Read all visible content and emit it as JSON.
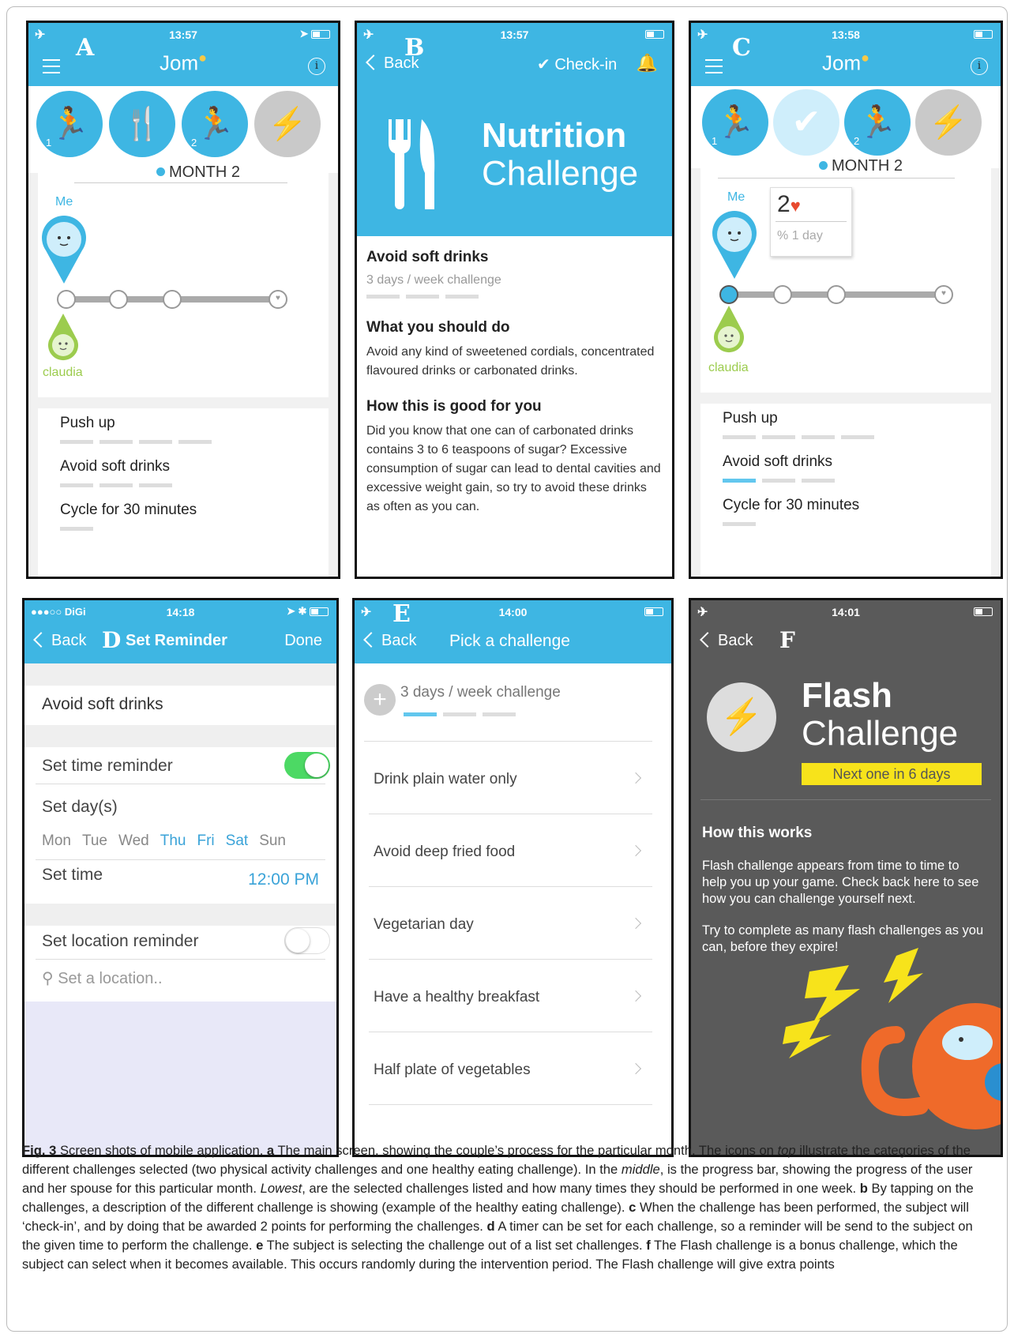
{
  "panel_a": {
    "letter": "A",
    "time": "13:57",
    "app_title": "Jom",
    "icon_badges": [
      "1",
      "2"
    ],
    "month": "MONTH 2",
    "me_label": "Me",
    "spouse_label": "claudia",
    "challenges": [
      {
        "title": "Push up",
        "segments": 4,
        "done": 0
      },
      {
        "title": "Avoid soft drinks",
        "segments": 3,
        "done": 0
      },
      {
        "title": "Cycle for 30 minutes",
        "segments": 1,
        "done": 0
      }
    ]
  },
  "panel_b": {
    "letter": "B",
    "time": "13:57",
    "back": "Back",
    "checkin": "Check-in",
    "hero_title": "Nutrition",
    "hero_subtitle": "Challenge",
    "challenge_title": "Avoid soft drinks",
    "frequency": "3 days / week challenge",
    "what_heading": "What you should do",
    "what_text": "Avoid any kind of sweetened cordials, concentrated flavoured drinks or carbonated drinks.",
    "how_heading": "How this is good for you",
    "how_text": "Did you know that one can of carbonated drinks contains 3 to 6 teaspoons of sugar? Excessive consumption of sugar can lead to dental cavities and excessive weight gain, so try to avoid these drinks as often as you can."
  },
  "panel_c": {
    "letter": "C",
    "time": "13:58",
    "app_title": "Jom",
    "icon_badges": [
      "1",
      "2"
    ],
    "month": "MONTH 2",
    "me_label": "Me",
    "points": "2",
    "streak": "1 day",
    "spouse_label": "claudia",
    "challenges": [
      {
        "title": "Push up",
        "segments": 4,
        "done": 0
      },
      {
        "title": "Avoid soft drinks",
        "segments": 3,
        "done": 1
      },
      {
        "title": "Cycle for 30 minutes",
        "segments": 1,
        "done": 0
      }
    ]
  },
  "panel_d": {
    "letter": "D",
    "carrier": "●●●○○ DiGi",
    "time": "14:18",
    "back": "Back",
    "title": "Set Reminder",
    "done": "Done",
    "challenge": "Avoid soft drinks",
    "time_reminder_label": "Set time reminder",
    "time_reminder_on": true,
    "days_label": "Set day(s)",
    "days": [
      {
        "d": "Mon",
        "sel": false
      },
      {
        "d": "Tue",
        "sel": false
      },
      {
        "d": "Wed",
        "sel": false
      },
      {
        "d": "Thu",
        "sel": true
      },
      {
        "d": "Fri",
        "sel": true
      },
      {
        "d": "Sat",
        "sel": true
      },
      {
        "d": "Sun",
        "sel": false
      }
    ],
    "set_time_label": "Set time",
    "set_time_value": "12:00 PM",
    "location_label": "Set location reminder",
    "location_on": false,
    "location_placeholder": "Set a location.."
  },
  "panel_e": {
    "letter": "E",
    "time": "14:00",
    "back": "Back",
    "title": "Pick a challenge",
    "frequency": "3 days / week challenge",
    "items": [
      "Drink plain water only",
      "Avoid deep fried food",
      "Vegetarian day",
      "Have a healthy breakfast",
      "Half plate of vegetables"
    ]
  },
  "panel_f": {
    "letter": "F",
    "time": "14:01",
    "back": "Back",
    "hero_title": "Flash",
    "hero_subtitle": "Challenge",
    "next": "Next one in 6 days",
    "how_heading": "How this works",
    "para1": "Flash challenge appears from time to time to help you up your game. Check back here to see how you can challenge yourself next.",
    "para2": "Try to complete as many flash challenges as you can, before they expire!"
  },
  "caption": {
    "fig": "Fig. 3",
    "intro": " Screen shots of mobile application. ",
    "a": "a",
    "a_text": " The main screen, showing the couple’s process for the particular month. The icons on ",
    "top": "top",
    "a_text2": " illustrate the categories of the different challenges selected (two physical activity challenges and one healthy eating challenge). In the ",
    "middle": "middle",
    "a_text3": ", is the progress bar, showing the progress of the user and her spouse for this particular month. ",
    "lowest": "Lowest",
    "a_text4": ", are the selected challenges listed and how many times they should be performed in one week. ",
    "b": "b",
    "b_text": " By tapping on the challenges, a description of the different challenge is showing (example of the healthy eating challenge). ",
    "c": "c",
    "c_text": " When the challenge has been performed, the subject will ‘check-in’, and by doing that be awarded 2 points for performing the challenges. ",
    "d": "d",
    "d_text": " A timer can be set for each challenge, so a reminder will be send to the subject on the given time to perform the challenge. ",
    "e": "e",
    "e_text": " The subject is selecting the challenge out of a list set challenges. ",
    "f": "f",
    "f_text": " The Flash challenge is a bonus challenge, which the subject can select when it becomes available. This occurs randomly during the intervention period. The Flash challenge will give extra points"
  },
  "colors": {
    "accent": "#3eb6e3",
    "spouse": "#9ccc4e",
    "toggle_on": "#4cd964",
    "flash_bg": "#5a5a5a",
    "flash_badge": "#f7e31b"
  }
}
